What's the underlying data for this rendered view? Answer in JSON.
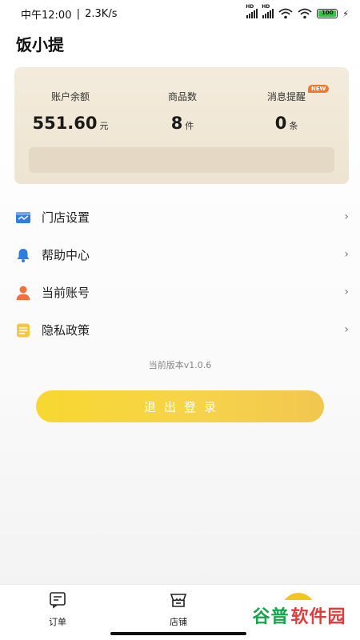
{
  "status_bar": {
    "time": "中午12:00",
    "speed": "2.3K/s",
    "signal_1_label": "HD",
    "signal_2_label": "HD",
    "battery_level": "100"
  },
  "app": {
    "title": "饭小提"
  },
  "stats": {
    "balance": {
      "label": "账户余额",
      "value": "551.60",
      "unit": "元"
    },
    "products": {
      "label": "商品数",
      "value": "8",
      "unit": "件"
    },
    "messages": {
      "label": "消息提醒",
      "value": "0",
      "unit": "条",
      "badge": "NEW"
    }
  },
  "menu": {
    "items": [
      {
        "label": "门店设置",
        "icon": "store-settings-icon",
        "chevron": "›"
      },
      {
        "label": "帮助中心",
        "icon": "bell-icon",
        "chevron": "›"
      },
      {
        "label": "当前账号",
        "icon": "user-icon",
        "chevron": "›"
      },
      {
        "label": "隐私政策",
        "icon": "document-icon",
        "chevron": "›"
      }
    ]
  },
  "version": "当前版本v1.0.6",
  "logout_label": "退出登录",
  "tabs": [
    {
      "label": "订单",
      "icon": "orders-icon"
    },
    {
      "label": "店铺",
      "icon": "store-icon"
    },
    {
      "label": "",
      "icon": "mine-icon"
    }
  ],
  "watermark": {
    "part1": "谷普",
    "part2": "软件园"
  },
  "colors": {
    "accent": "#f5c51f",
    "card_bg": "#f1e8d7",
    "badge": "#f0782d",
    "store_icon": "#2f7de1",
    "user_icon": "#f2703a",
    "doc_icon": "#f5c744"
  }
}
